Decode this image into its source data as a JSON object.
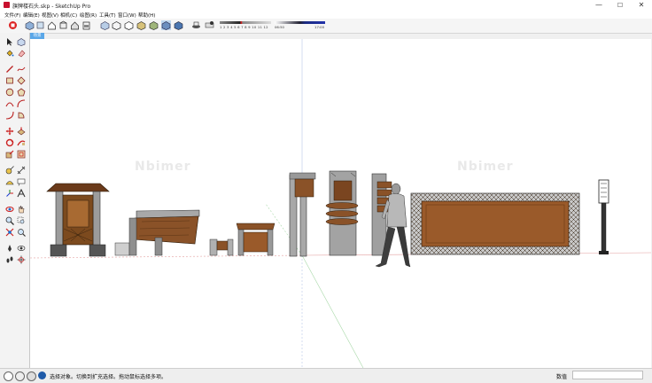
{
  "window": {
    "title": "旗牌楼石头.skp - SketchUp Pro",
    "minimize": "—",
    "maximize": "☐",
    "close": "✕"
  },
  "menu": {
    "items": [
      "文件(F)",
      "编辑(E)",
      "视图(V)",
      "相机(C)",
      "绘图(R)",
      "工具(T)",
      "窗口(W)",
      "帮助(H)"
    ]
  },
  "toolbar": {
    "shadow_ticks": "J F M A M J J A S O N D",
    "shadow_ticks_num": "1 2 3 4 5 6 7 8 9 10 11 12",
    "time_start": "06:50",
    "time_mid": "中午",
    "time_end": "17:00"
  },
  "scene": {
    "tab_label": "场景"
  },
  "viewport": {
    "watermark": "Nbimer"
  },
  "status": {
    "message": "选择对象。切换到扩充选择。拖动鼠标选择多项。",
    "measure_label": "数值",
    "measure_value": ""
  },
  "colors": {
    "accent": "#5aa7e8",
    "wood": "#9a5a2a",
    "stone": "#8a8a8a"
  }
}
